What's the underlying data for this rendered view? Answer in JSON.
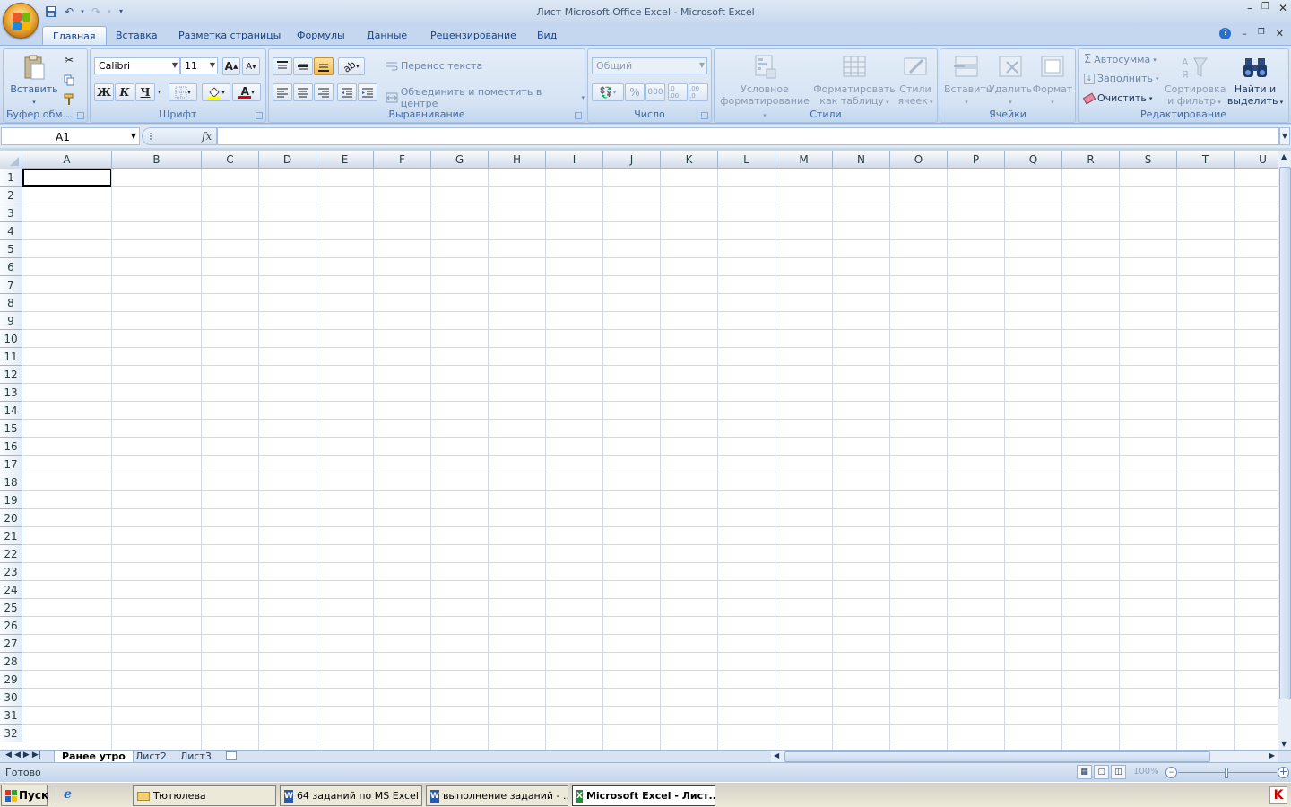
{
  "window": {
    "title": "Лист Microsoft Office Excel - Microsoft Excel"
  },
  "ribbon_tabs": [
    "Главная",
    "Вставка",
    "Разметка страницы",
    "Формулы",
    "Данные",
    "Рецензирование",
    "Вид"
  ],
  "clipboard": {
    "paste_label": "Вставить",
    "group_label": "Буфер обм..."
  },
  "font": {
    "name": "Calibri",
    "size": "11",
    "bold": "Ж",
    "italic": "К",
    "underline": "Ч",
    "grow": "A",
    "shrink": "A",
    "color_letter": "A",
    "group_label": "Шрифт"
  },
  "alignment": {
    "wrap_label": "Перенос текста",
    "merge_label": "Объединить и поместить в центре",
    "group_label": "Выравнивание"
  },
  "number": {
    "format": "Общий",
    "percent": "%",
    "thousands": "000",
    "inc_dec": ",0 .00",
    "dec_dec": ",00 ,0",
    "group_label": "Число"
  },
  "styles": {
    "conditional_line1": "Условное",
    "conditional_line2": "форматирование",
    "as_table_line1": "Форматировать",
    "as_table_line2": "как таблицу",
    "cell_styles_line1": "Стили",
    "cell_styles_line2": "ячеек",
    "group_label": "Стили"
  },
  "cells": {
    "insert": "Вставить",
    "delete": "Удалить",
    "format": "Формат",
    "group_label": "Ячейки"
  },
  "editing": {
    "autosum": "Автосумма",
    "fill": "Заполнить",
    "clear": "Очистить",
    "sort_line1": "Сортировка",
    "sort_line2": "и фильтр",
    "find_line1": "Найти и",
    "find_line2": "выделить",
    "group_label": "Редактирование"
  },
  "formula_bar": {
    "name_box": "A1",
    "fx": "fx",
    "formula": ""
  },
  "columns": [
    "A",
    "B",
    "C",
    "D",
    "E",
    "F",
    "G",
    "H",
    "I",
    "J",
    "K",
    "L",
    "M",
    "N",
    "O",
    "P",
    "Q",
    "R",
    "S",
    "T",
    "U"
  ],
  "rows": [
    "1",
    "2",
    "3",
    "4",
    "5",
    "6",
    "7",
    "8",
    "9",
    "10",
    "11",
    "12",
    "13",
    "14",
    "15",
    "16",
    "17",
    "18",
    "19",
    "20",
    "21",
    "22",
    "23",
    "24",
    "25",
    "26",
    "27",
    "28",
    "29",
    "30",
    "31",
    "32"
  ],
  "sheets": [
    "Ранее утро",
    "Лист2",
    "Лист3"
  ],
  "status": {
    "text": "Готово",
    "zoom": "100%"
  },
  "taskbar": {
    "start": "Пуск",
    "items": [
      "Тютюлева",
      "64 заданий по MS Excel ...",
      "выполнение заданий - ...",
      "Microsoft Excel - Лист..."
    ]
  },
  "colors": {
    "ribbon": "#d3e1f2",
    "accent": "#15428b",
    "grid": "#d0d7e5"
  }
}
